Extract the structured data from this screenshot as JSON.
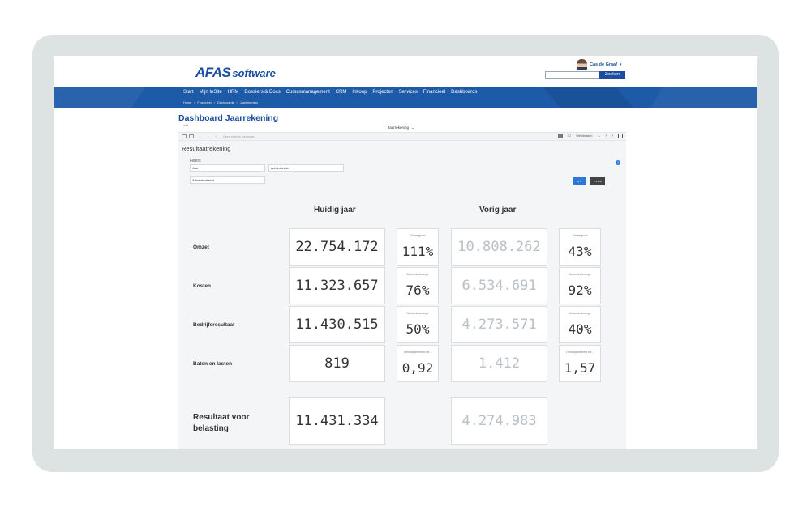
{
  "brand": {
    "afas": "AFAS",
    "software": "software"
  },
  "user": {
    "name": "Cas de Graaf"
  },
  "search": {
    "placeholder": "",
    "button": "Zoeken"
  },
  "menu": [
    "Start",
    "Mijn InSite",
    "HRM",
    "Dossiers & Docs",
    "Cursusmanagement",
    "CRM",
    "Inkoop",
    "Projecten",
    "Services",
    "Financieel",
    "Dashboards"
  ],
  "breadcrumb": [
    "Home",
    "Financieel",
    "Dashboards",
    "Jaarrekening"
  ],
  "page_title": "Dashboard Jaarrekening",
  "tabbar": {
    "dots": "•••",
    "selected": "Jaarrekening"
  },
  "toolbar": {
    "status": "Geen selectie toegepast",
    "werkbladen": "Werkbladen"
  },
  "section_title": "Resultaatrekening",
  "filters": {
    "label": "Filters",
    "jaar": "Jaar",
    "administratie": "Administratie",
    "administratieset": "Administratieset"
  },
  "scale_buttons": {
    "x1": "x 1",
    "x1000": "x 1.000"
  },
  "columns": {
    "current": "Huidig jaar",
    "previous": "Vorig jaar"
  },
  "rows": [
    {
      "label": "Omzet",
      "current": "22.754.172",
      "ratio_current_label": "Omzetgroei",
      "ratio_current": "111%",
      "previous": "10.808.262",
      "ratio_previous_label": "Omzetgroei",
      "ratio_previous": "43%"
    },
    {
      "label": "Kosten",
      "current": "11.323.657",
      "ratio_current_label": "Brutowinstmarge",
      "ratio_current": "76%",
      "previous": "6.534.691",
      "ratio_previous_label": "Brutowinstmarge",
      "ratio_previous": "92%"
    },
    {
      "label": "Bedrijfsresultaat",
      "current": "11.430.515",
      "ratio_current_label": "Nettowinstmarge",
      "ratio_current": "50%",
      "previous": "4.273.571",
      "ratio_previous_label": "Nettowinstmarge",
      "ratio_previous": "40%"
    },
    {
      "label": "Baten en lasten",
      "current": "819",
      "ratio_current_label": "Omloopsnelheid tot...",
      "ratio_current": "0,92",
      "previous": "1.412",
      "ratio_previous_label": "Omloopsnelheid tot...",
      "ratio_previous": "1,57"
    }
  ],
  "result": {
    "label": "Resultaat voor belasting",
    "current": "11.431.334",
    "previous": "4.274.983"
  }
}
